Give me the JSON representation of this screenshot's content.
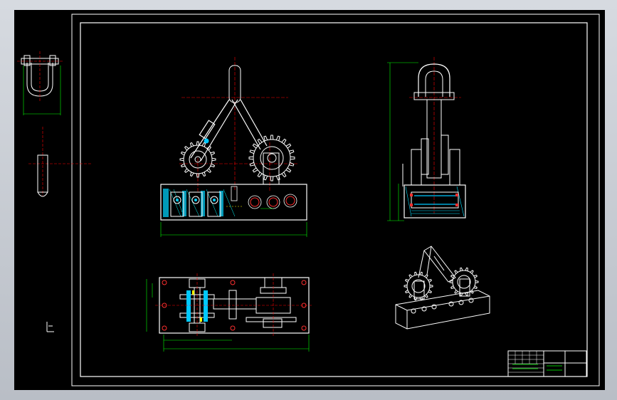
{
  "window": {
    "title": ""
  },
  "colors": {
    "background": "#000000",
    "frame": "#ffffff",
    "part": "#ffffff",
    "centerline": "#ff0000",
    "dimension": "#00ff00",
    "hatch": "#00d8ff",
    "hidden": "#ffff00",
    "highlight": "#00a0ff"
  },
  "title_block": {
    "rows": 6,
    "label_cells": [
      "",
      "",
      "",
      "",
      "",
      ""
    ]
  },
  "icons": [
    "ucs-icon",
    "gear-icon",
    "shackle-icon"
  ]
}
